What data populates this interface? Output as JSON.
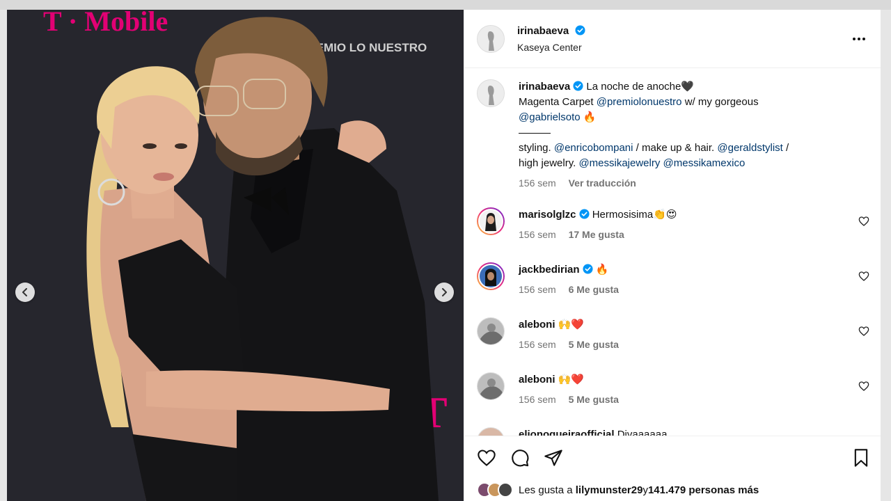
{
  "post": {
    "username": "irinabaeva",
    "location": "Kaseya Center",
    "caption_line1": "La noche de anoche🖤",
    "caption_line2_a": "Magenta Carpet ",
    "caption_mention1": "@premiolonuestro",
    "caption_line2_b": " w/ my gorgeous",
    "caption_mention2": "@gabrielsoto",
    "caption_line3_emoji": " 🔥",
    "caption_line5_a": "styling. ",
    "caption_mention3": "@enricobompani",
    "caption_line5_b": " / make up & hair. ",
    "caption_mention4": "@geraldstylist",
    "caption_line5_c": " /",
    "caption_line6_a": "high jewelry. ",
    "caption_mention5": "@messikajewelry",
    "caption_mention6": "@messikamexico",
    "time": "156 sem",
    "translate": "Ver traducción"
  },
  "comments": [
    {
      "author": "marisolglzc",
      "text": "Hermosisima👏😍",
      "verified": true,
      "time": "156 sem",
      "likes": "17 Me gusta"
    },
    {
      "author": "jackbedirian",
      "text": "🔥",
      "verified": true,
      "time": "156 sem",
      "likes": "6 Me gusta"
    },
    {
      "author": "aleboni",
      "text": "🙌❤️",
      "verified": false,
      "time": "156 sem",
      "likes": "5 Me gusta"
    },
    {
      "author": "aleboni",
      "text": "🙌❤️",
      "verified": false,
      "time": "156 sem",
      "likes": "5 Me gusta"
    },
    {
      "author": "elionogueiraofficial",
      "text": "Divaaaaaa",
      "verified": false
    }
  ],
  "likes_line": {
    "prefix": "Les gusta a ",
    "user": "lilymunster29",
    "mid": " y ",
    "count": "141.479 personas más"
  },
  "photo": {
    "sponsor_text": "T · Mobile",
    "backdrop_text": "PREMIO LO NUESTRO",
    "backdrop_letter": "T"
  },
  "icons": [
    "chevron-left-icon",
    "chevron-right-icon",
    "more-icon",
    "verified-icon",
    "heart-icon",
    "comment-icon",
    "share-icon",
    "bookmark-icon"
  ],
  "colors": {
    "accent": "#0095f6",
    "mention": "#00376b",
    "magenta": "#e20074"
  }
}
